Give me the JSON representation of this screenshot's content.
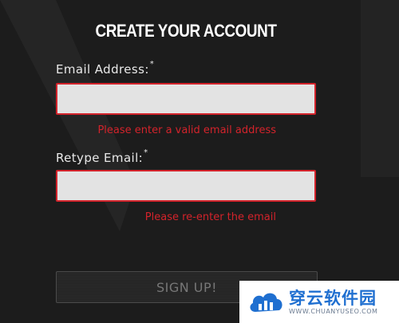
{
  "form": {
    "title": "CREATE YOUR ACCOUNT",
    "email": {
      "label": "Email Address:",
      "required_mark": "*",
      "value": "",
      "error": "Please enter a valid email address"
    },
    "retype_email": {
      "label": "Retype Email:",
      "required_mark": "*",
      "value": "",
      "error": "Please re-enter the email"
    },
    "signup_label": "SIGN UP!"
  },
  "watermark": {
    "cn_text": "穿云软件园",
    "en_text": "WWW.CHUANYUSEO.COM"
  },
  "colors": {
    "background": "#1c1c1c",
    "error": "#d3232b",
    "input_fill": "#e3e3e3",
    "watermark_blue": "#1f6fd0"
  }
}
